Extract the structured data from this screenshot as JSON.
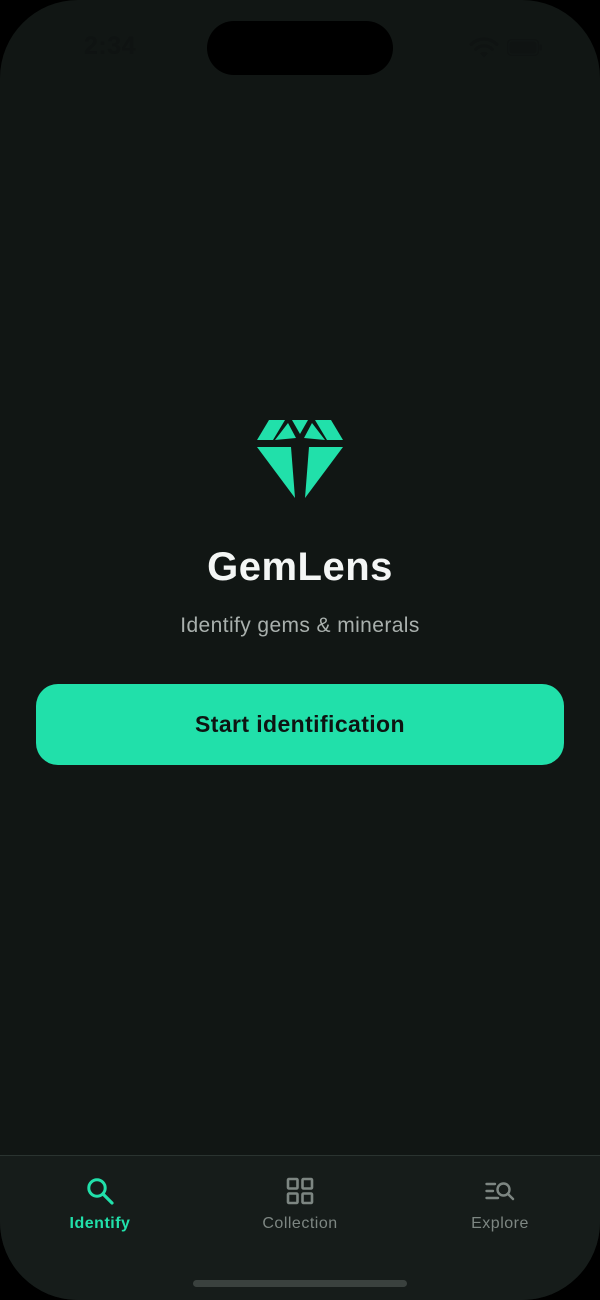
{
  "status_bar": {
    "time": "2:34"
  },
  "app": {
    "title": "GemLens",
    "subtitle": "Identify gems & minerals",
    "logo_icon": "diamond-icon"
  },
  "primary_action": {
    "label": "Start identification"
  },
  "tab_bar": {
    "tabs": [
      {
        "label": "Identify",
        "icon": "search-icon",
        "active": true
      },
      {
        "label": "Collection",
        "icon": "grid-icon",
        "active": false
      },
      {
        "label": "Explore",
        "icon": "list-search-icon",
        "active": false
      }
    ]
  },
  "colors": {
    "background": "#111614",
    "accent": "#21e0aa",
    "text_primary": "#f4f6f5",
    "text_secondary": "#a9b0ad",
    "tab_inactive": "#7d8682"
  }
}
